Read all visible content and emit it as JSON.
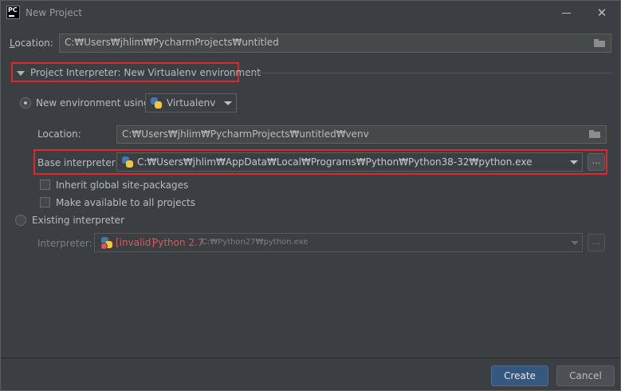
{
  "window": {
    "title": "New Project",
    "app_icon_text": "PC"
  },
  "location": {
    "label": "Location:",
    "value": "C:₩Users₩jhlim₩PycharmProjects₩untitled"
  },
  "interpreter_section": {
    "title": "Project Interpreter: New Virtualenv environment",
    "new_env": {
      "label": "New environment using",
      "selected": true,
      "tool": "Virtualenv",
      "location_label": "Location:",
      "location_value": "C:₩Users₩jhlim₩PycharmProjects₩untitled₩venv",
      "base_label": "Base interpreter:",
      "base_value": "C:₩Users₩jhlim₩AppData₩Local₩Programs₩Python₩Python38-32₩python.exe",
      "inherit_label": "Inherit global site-packages",
      "inherit_checked": false,
      "available_label": "Make available to all projects",
      "available_checked": false
    },
    "existing": {
      "label": "Existing interpreter",
      "selected": false,
      "interpreter_label": "Interpreter:",
      "invalid_tag": "[invalid]",
      "name": "Python 2.7",
      "path": "C:₩Python27₩python.exe"
    }
  },
  "buttons": {
    "browse": "...",
    "create": "Create",
    "cancel": "Cancel"
  },
  "colors": {
    "background": "#3c3f41",
    "highlight_box": "#e0262e",
    "primary_button": "#365880",
    "invalid_text": "#e05555"
  }
}
